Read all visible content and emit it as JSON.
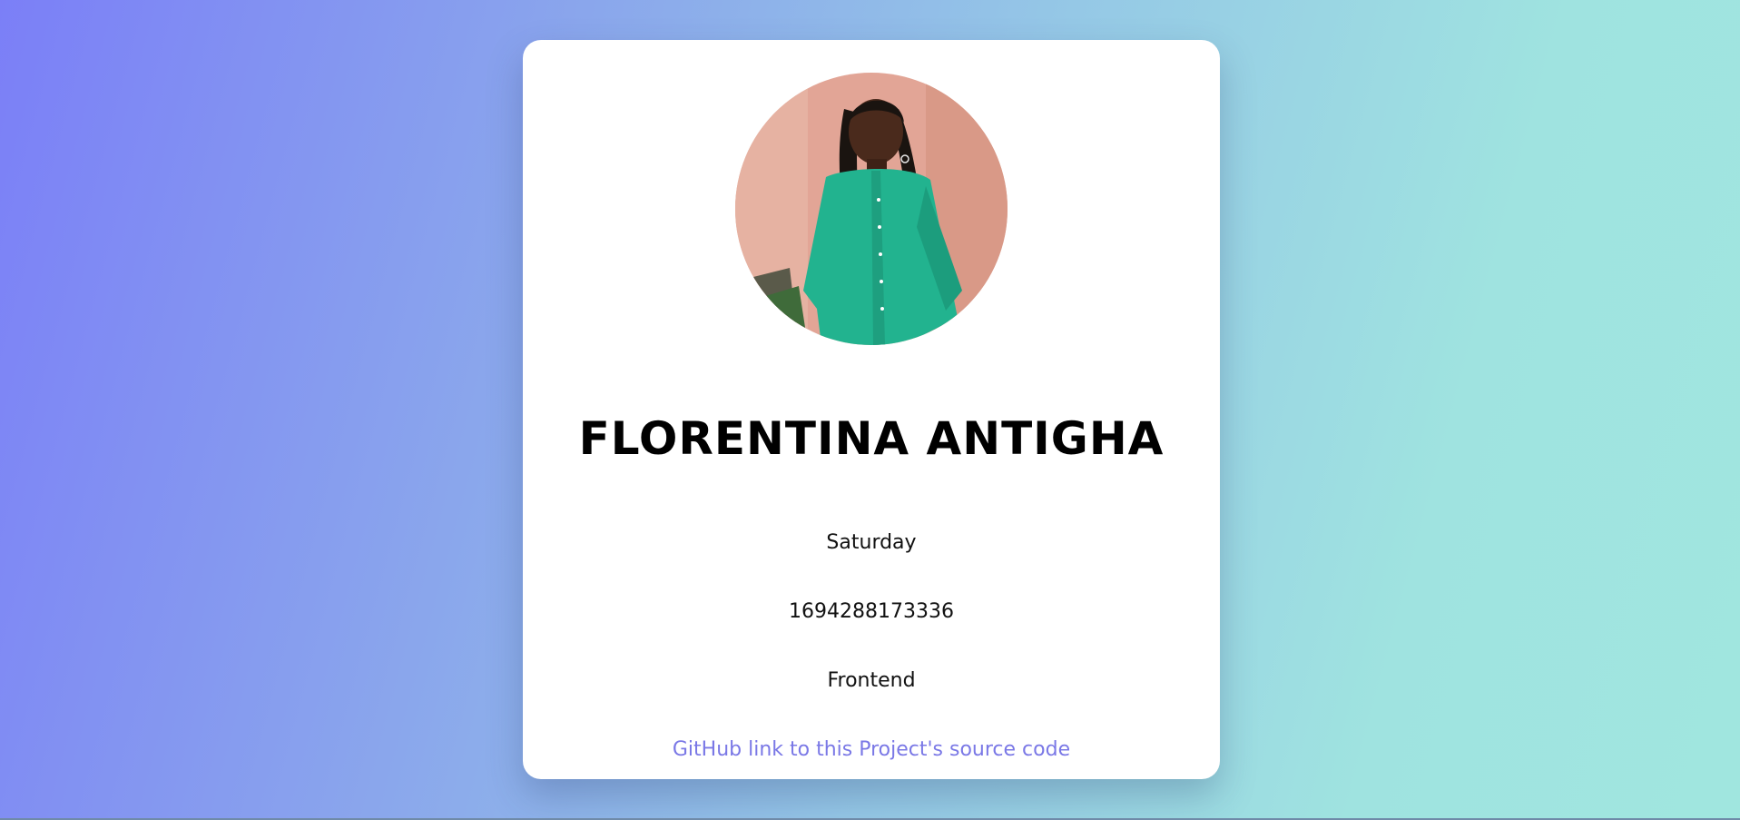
{
  "profile": {
    "name": "FLORENTINA ANTIGHA",
    "day": "Saturday",
    "utc_time": "1694288173336",
    "track": "Frontend",
    "github_link_label": "GitHub link to this Project's source code"
  },
  "colors": {
    "card_background": "#ffffff",
    "link": "#7a78e6",
    "gradient_start": "#7b7ff7",
    "gradient_end": "#a0e6df"
  }
}
